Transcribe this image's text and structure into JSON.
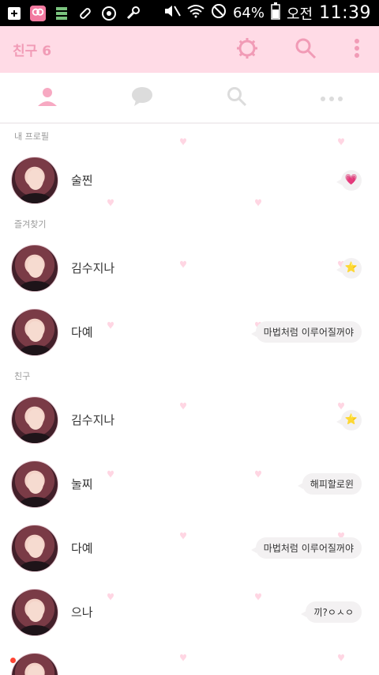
{
  "status_bar": {
    "battery": "64%",
    "ampm": "오전",
    "time": "11:39"
  },
  "app_bar": {
    "title": "친구 6"
  },
  "tabs": [
    {
      "name": "friends"
    },
    {
      "name": "chats"
    },
    {
      "name": "search"
    },
    {
      "name": "more"
    }
  ],
  "sections": {
    "my_profile": "내 프로필",
    "favorites": "즐겨찾기",
    "friends": "친구"
  },
  "my_profile": {
    "name": "술찐",
    "emoji": "💗"
  },
  "favorites": [
    {
      "name": "김수지나",
      "emoji": "⭐"
    },
    {
      "name": "다예",
      "status": "마법처럼 이루어질꺼야"
    }
  ],
  "friends": [
    {
      "name": "김수지나",
      "emoji": "⭐"
    },
    {
      "name": "눌찌",
      "status": "해피할로윈"
    },
    {
      "name": "다예",
      "status": "마법처럼 이루어질꺼야"
    },
    {
      "name": "으나",
      "status": "끼?ㅇㅅㅇ"
    }
  ],
  "colors": {
    "accent": "#f19bb6",
    "appbar_bg": "#ffdbe6",
    "heart": "#ffdbe6"
  }
}
